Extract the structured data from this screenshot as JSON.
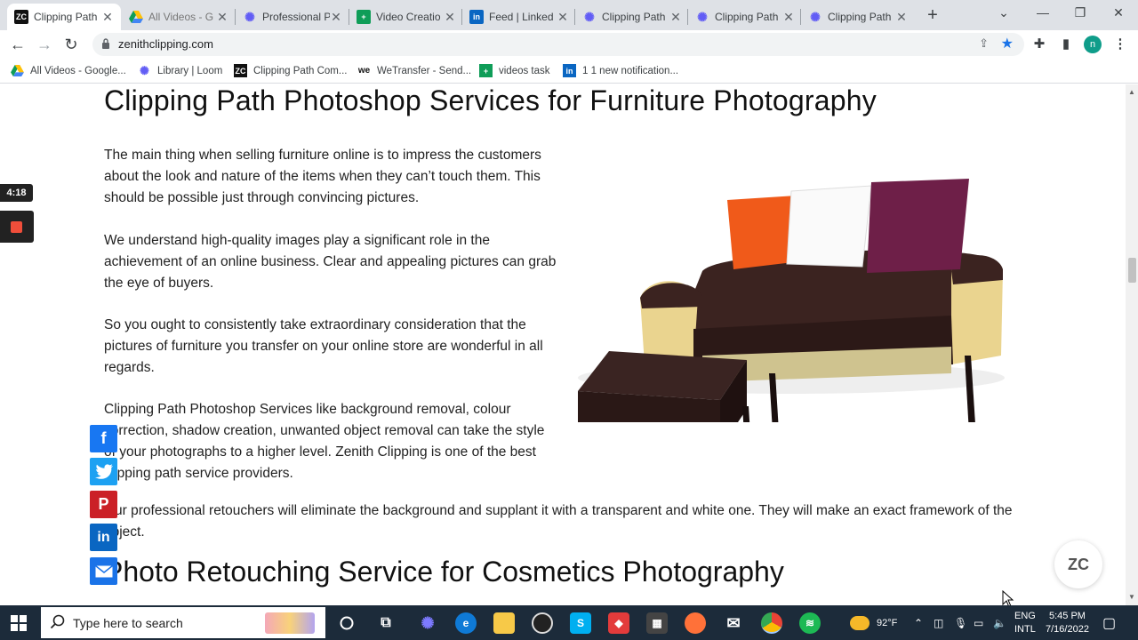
{
  "browser": {
    "tabs": [
      {
        "title": "Clipping Path",
        "icon": "zc-favicon",
        "active": true
      },
      {
        "title": "All Videos - G",
        "icon": "google-drive-icon",
        "active": false
      },
      {
        "title": "Professional P",
        "icon": "loom-icon",
        "active": false
      },
      {
        "title": "Video Creatio",
        "icon": "google-sheets-icon",
        "active": false
      },
      {
        "title": "Feed | Linked",
        "icon": "linkedin-icon",
        "active": false
      },
      {
        "title": "Clipping Path",
        "icon": "loom-icon",
        "active": false
      },
      {
        "title": "Clipping Path",
        "icon": "loom-icon",
        "active": false
      },
      {
        "title": "Clipping Path",
        "icon": "loom-icon",
        "active": false
      }
    ],
    "url": "zenithclipping.com",
    "profile_initial": "n",
    "bookmarks": [
      {
        "label": "All Videos - Google...",
        "icon": "google-drive-icon"
      },
      {
        "label": "Library | Loom",
        "icon": "loom-icon"
      },
      {
        "label": "Clipping Path Com...",
        "icon": "zc-favicon"
      },
      {
        "label": "WeTransfer - Send...",
        "icon": "wetransfer-icon"
      },
      {
        "label": "videos task",
        "icon": "google-sheets-icon"
      },
      {
        "label": "1 1 new notification...",
        "icon": "linkedin-icon"
      }
    ]
  },
  "page": {
    "heading": "Clipping Path Photoshop Services for Furniture Photography",
    "paragraphs": [
      "The main thing when selling furniture online is to impress the customers about the look and nature of the items when they can’t touch them. This should be possible just through convincing pictures.",
      "We understand high-quality images play a significant role in the achievement of an online business. Clear and appealing pictures can grab the eye of buyers.",
      "So you ought to consistently take extraordinary consideration that the pictures of furniture you transfer on your online store are wonderful in all regards.",
      "Clipping Path Photoshop Services like background removal, colour correction, shadow creation, unwanted object removal can take the style of your photographs to a higher level. Zenith Clipping is one of the best clipping path service providers."
    ],
    "wide_paragraph": "Our professional retouchers will eliminate the background and supplant it with a transparent and white one. They will make an exact framework of the object.",
    "heading2": "Photo Retouching Service for Cosmetics Photography",
    "badge_text": "ZC"
  },
  "recorder": {
    "timer": "4:18"
  },
  "taskbar": {
    "search_placeholder": "Type here to search",
    "temperature": "92°F",
    "language_top": "ENG",
    "language_bottom": "INTL",
    "time": "5:45 PM",
    "date": "7/16/2022"
  },
  "colors": {
    "accent": "#1a73e8",
    "facebook": "#1877f2",
    "twitter": "#1da1f2",
    "pinterest": "#cb2027",
    "linkedin": "#0a66c2",
    "email": "#1a73e8"
  }
}
